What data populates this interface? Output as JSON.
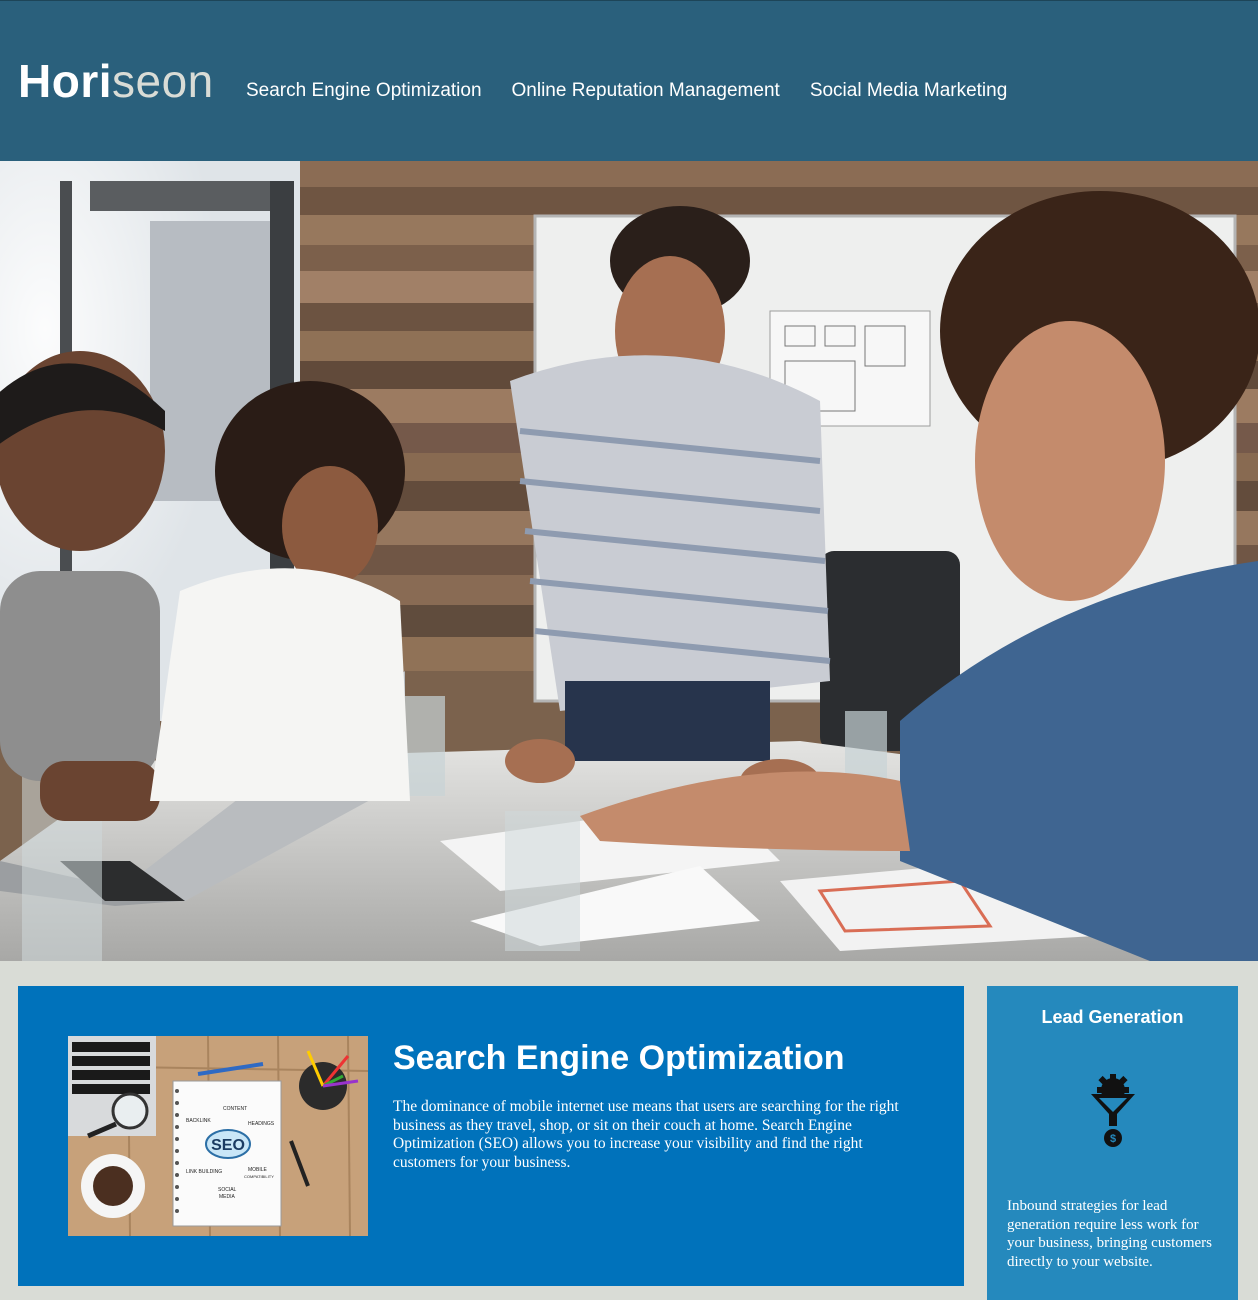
{
  "header": {
    "logo_primary": "Hori",
    "logo_accent": "seon",
    "nav": [
      {
        "label": "Search Engine Optimization"
      },
      {
        "label": "Online Reputation Management"
      },
      {
        "label": "Social Media Marketing"
      }
    ]
  },
  "colors": {
    "header_bg": "#2a607c",
    "page_bg": "#d9dcd6",
    "content_bg": "#0072bb",
    "sidebar_bg": "#2589bd"
  },
  "hero": {
    "icon": "team-meeting-photo"
  },
  "content": {
    "seo": {
      "image_words": [
        "CONTENT",
        "BACKLINK",
        "HEADINGS",
        "SEO",
        "LINK BUILDING",
        "MOBILE",
        "COMPATIBILITY",
        "SOCIAL",
        "MEDIA"
      ],
      "title": "Search Engine Optimization",
      "text": "The dominance of mobile internet use means that users are searching for the right business as they travel, shop, or sit on their couch at home. Search Engine Optimization (SEO) allows you to increase your visibility and find the right customers for your business."
    }
  },
  "sidebar": {
    "lead_generation": {
      "title": "Lead Generation",
      "icon": "lead-funnel-icon",
      "text": "Inbound strategies for lead generation require less work for your business, bringing customers directly to your website."
    }
  }
}
